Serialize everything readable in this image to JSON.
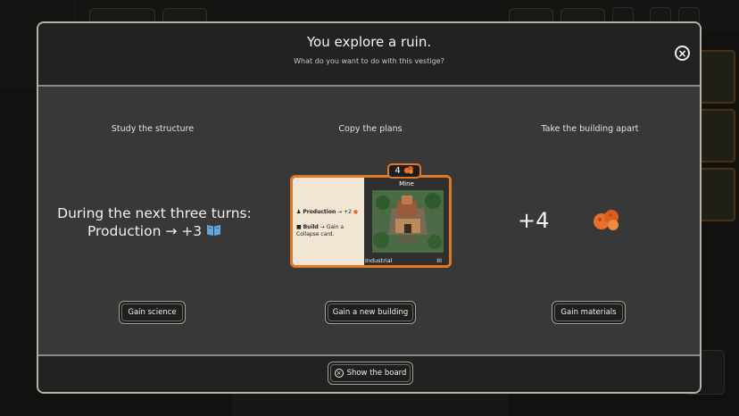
{
  "modal": {
    "title": "You explore a ruin.",
    "subtitle": "What do you want to do with this vestige?",
    "close_icon": "close-icon"
  },
  "options": [
    {
      "title": "Study the structure",
      "description_line1": "During the next three turns:",
      "description_line2": "Production → +3",
      "icon": "science-book-icon",
      "button_label": "Gain science"
    },
    {
      "title": "Copy the plans",
      "button_label": "Gain a new building",
      "card": {
        "cost": "4",
        "cost_icon": "materials-icon",
        "name": "Mine",
        "effect1_label": "Production",
        "effect1_value": "→ +2",
        "effect2_label": "Build",
        "effect2_value": "→ Gain a",
        "effect2_value2": "Collapse card.",
        "type": "Industrial",
        "tier": "III"
      }
    },
    {
      "title": "Take the building apart",
      "amount": "+4",
      "icon": "materials-icon",
      "button_label": "Gain materials"
    }
  ],
  "footer": {
    "show_board_label": "Show the board",
    "show_board_icon": "close-circle-icon"
  },
  "colors": {
    "accent_orange": "#e0782a",
    "science_blue": "#5fa8e0",
    "materials_orange": "#e8702a"
  }
}
